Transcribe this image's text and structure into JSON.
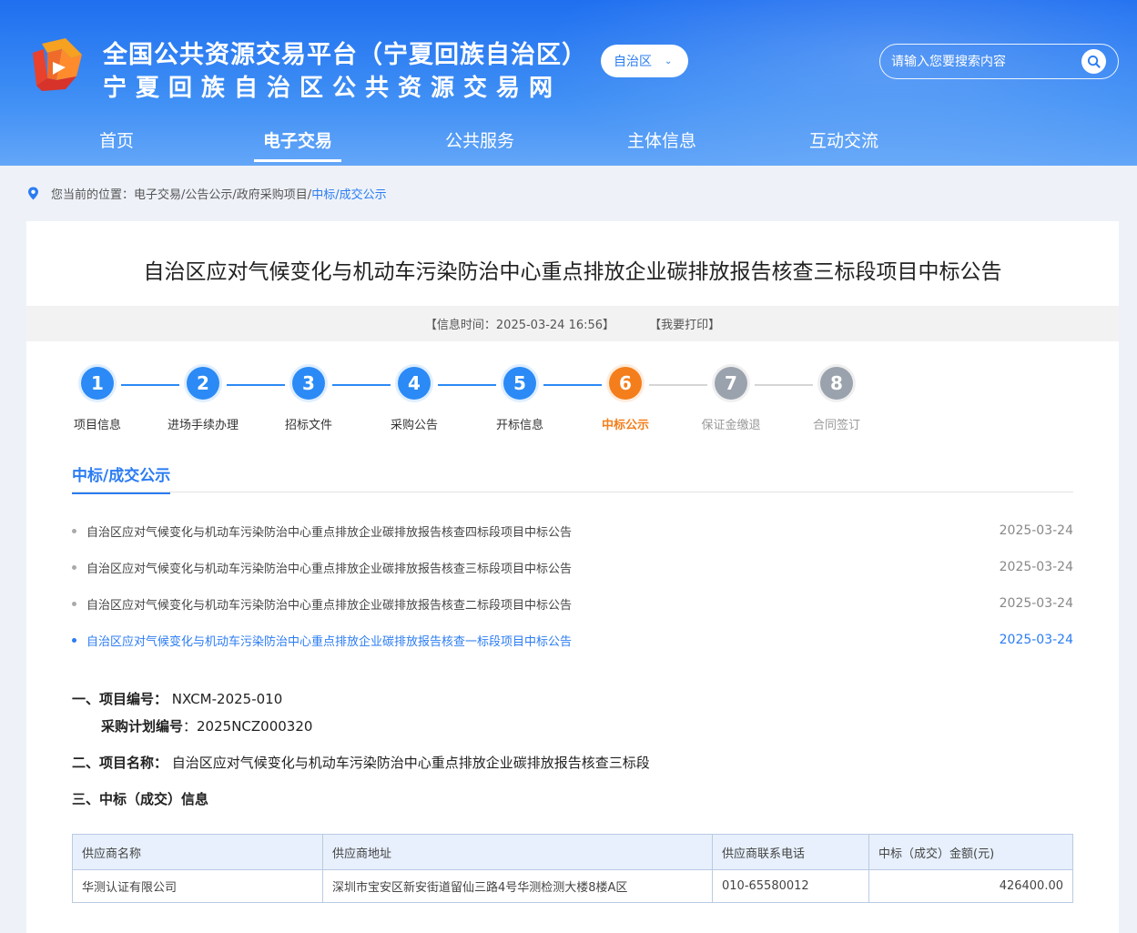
{
  "header": {
    "title": "全国公共资源交易平台（宁夏回族自治区）",
    "subtitle": "宁夏回族自治区公共资源交易网",
    "region_select": "自治区",
    "search_placeholder": "请输入您要搜索内容"
  },
  "nav": {
    "items": [
      {
        "label": "首页"
      },
      {
        "label": "电子交易"
      },
      {
        "label": "公共服务"
      },
      {
        "label": "主体信息"
      },
      {
        "label": "互动交流"
      }
    ],
    "active": "电子交易"
  },
  "breadcrumb": {
    "prefix": "您当前的位置：",
    "items": [
      "电子交易/",
      "公告公示/",
      "政府采购项目/"
    ],
    "current": "中标/成交公示"
  },
  "article": {
    "title": "自治区应对气候变化与机动车污染防治中心重点排放企业碳排放报告核查三标段项目中标公告",
    "info_time": "【信息时间：2025-03-24 16:56】",
    "print": "【我要打印】"
  },
  "steps": [
    {
      "num": "1",
      "label": "项目信息",
      "state": "done"
    },
    {
      "num": "2",
      "label": "进场手续办理",
      "state": "done"
    },
    {
      "num": "3",
      "label": "招标文件",
      "state": "done"
    },
    {
      "num": "4",
      "label": "采购公告",
      "state": "done"
    },
    {
      "num": "5",
      "label": "开标信息",
      "state": "done"
    },
    {
      "num": "6",
      "label": "中标公示",
      "state": "current"
    },
    {
      "num": "7",
      "label": "保证金缴退",
      "state": "todo"
    },
    {
      "num": "8",
      "label": "合同签订",
      "state": "todo"
    }
  ],
  "section": {
    "tab": "中标/成交公示",
    "notices": [
      {
        "title": "自治区应对气候变化与机动车污染防治中心重点排放企业碳排放报告核查四标段项目中标公告",
        "date": "2025-03-24"
      },
      {
        "title": "自治区应对气候变化与机动车污染防治中心重点排放企业碳排放报告核查三标段项目中标公告",
        "date": "2025-03-24"
      },
      {
        "title": "自治区应对气候变化与机动车污染防治中心重点排放企业碳排放报告核查二标段项目中标公告",
        "date": "2025-03-24"
      },
      {
        "title": "自治区应对气候变化与机动车污染防治中心重点排放企业碳排放报告核查一标段项目中标公告",
        "date": "2025-03-24"
      }
    ]
  },
  "details": {
    "project_no_label": "一、项目编号：",
    "project_no": "NXCM-2025-010",
    "plan_no_label": "采购计划编号",
    "plan_no": "：2025NCZ000320",
    "project_name_label": "二、项目名称：",
    "project_name": "自治区应对气候变化与机动车污染防治中心重点排放企业碳排放报告核查三标段",
    "award_label": "三、中标（成交）信息"
  },
  "table": {
    "headers": [
      "供应商名称",
      "供应商地址",
      "供应商联系电话",
      "中标（成交）金额(元)"
    ],
    "rows": [
      [
        "华测认证有限公司",
        "深圳市宝安区新安街道留仙三路4号华测检测大楼8楼A区",
        "010-65580012",
        "426400.00"
      ]
    ]
  },
  "colors": {
    "header_blue": "#1f6ff0",
    "accent_blue": "#2b7cf3",
    "current_step_orange": "#f37e1b",
    "todo_gray": "#9aa2ad"
  }
}
